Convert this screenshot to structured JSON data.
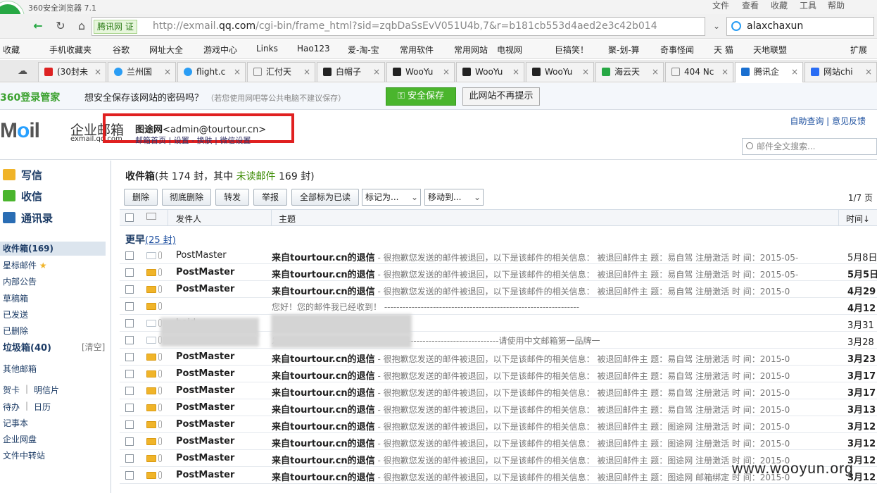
{
  "browser": {
    "app_title": "360安全浏览器 7.1",
    "menus": [
      "文件",
      "查看",
      "收藏",
      "工具",
      "帮助"
    ],
    "site_badge": "腾讯网 证",
    "url_prefix": "http://exmail.",
    "url_domain": "qq.com",
    "url_rest": "/cgi-bin/frame_html?sid=zqbDaSsEvV051U4b,7&r=b181cb553d4aed2e3c42b014",
    "search_text": "alaxchaxun"
  },
  "bookmarks": {
    "label": "收藏",
    "items": [
      "手机收藏夹",
      "谷歌",
      "网址大全",
      "游戏中心",
      "Links",
      "Hao123",
      "爱-淘-宝",
      "常用软件",
      "常用网站",
      "电视网",
      "巨搞笑！",
      "聚-划-算",
      "奇事怪闻",
      "天 猫",
      "天地联盟"
    ],
    "extend": "扩展"
  },
  "tabs": [
    "(30封未",
    "兰州国",
    "flight.c",
    "汇付天",
    "白帽子",
    "WooYu",
    "WooYu",
    "WooYu",
    "海云天",
    "404 Nc",
    "腾讯企",
    "网站chi"
  ],
  "password_bar": {
    "brand": "360登录管家",
    "question": "想安全保存该网站的密码吗？",
    "hint": "（若您使用网吧等公共电脑不建议保存）",
    "save_label": "安全保存",
    "no_label": "此网站不再提示"
  },
  "mail_header": {
    "logo_text": "Moil",
    "logo_cn": "企业邮箱",
    "logo_domain": "exmail.qq.com",
    "user_name": "图途网",
    "user_email": "<admin@tourtour.cn>",
    "user_links": "邮箱首页 | 设置 - 换肤 | 微信设置",
    "help_links": "自助查询 | 意见反馈",
    "search_placeholder": "邮件全文搜索..."
  },
  "sidebar": {
    "compose": "写信",
    "inbox_big": "收信",
    "contacts": "通讯录",
    "inbox": "收件箱(169)",
    "starred": "星标邮件",
    "internal": "内部公告",
    "drafts": "草稿箱",
    "sent": "已发送",
    "deleted": "已删除",
    "spam": "垃圾箱(40)",
    "spam_clear": "[清空]",
    "other": "其他邮箱",
    "greeting": "贺卡",
    "postcard": "明信片",
    "todo": "待办",
    "calendar": "日历",
    "notes": "记事本",
    "netdisk": "企业网盘",
    "transfer": "文件中转站"
  },
  "inbox": {
    "title": "收件箱",
    "summary": "(共 174 封，其中",
    "unread_label": "未读邮件",
    "unread_count": "169 封)",
    "toolbar": {
      "delete": "删除",
      "purge": "彻底删除",
      "forward": "转发",
      "report": "举报",
      "mark_all_read": "全部标为已读",
      "mark_as": "标记为...",
      "move_to": "移动到..."
    },
    "pager": "1/7 页",
    "columns": {
      "from": "发件人",
      "subject": "主题",
      "time": "时间↓"
    },
    "group_label": "更早",
    "group_count": "(25 封)",
    "rows": [
      {
        "from": "PostMaster",
        "subject": "来自tourtour.cn的退信",
        "preview": " - 很抱歉您发送的邮件被退回，以下是该邮件的相关信息：  被退回邮件主  题：易自驾 注册激活 时 间：2015-05-",
        "date": "5月8日",
        "unread": false
      },
      {
        "from": "PostMaster",
        "subject": "来自tourtour.cn的退信",
        "preview": " - 很抱歉您发送的邮件被退回，以下是该邮件的相关信息：  被退回邮件主  题：易自驾 注册激活 时 间：2015-05-",
        "date": "5月5日",
        "unread": true
      },
      {
        "from": "PostMaster",
        "subject": "来自tourtour.cn的退信",
        "preview": " - 很抱歉您发送的邮件被退回，以下是该邮件的相关信息：  被退回邮件主  题：易自驾 注册激活 时 间：2015-0",
        "date": "4月29",
        "unread": true
      },
      {
        "from": "",
        "subject": "",
        "preview": "您好！您的邮件我已经收到！  ----------------------------------------------------------------",
        "date": "4月12",
        "unread": true
      },
      {
        "from": "baid",
        "subject": "",
        "preview": "",
        "date": "3月31",
        "unread": false
      },
      {
        "from": "",
        "subject": "",
        "preview": "发给我的信件已经收到。--------------------------------------------请使用中文邮箱第一品牌一",
        "date": "3月28",
        "unread": false
      },
      {
        "from": "PostMaster",
        "subject": "来自tourtour.cn的退信",
        "preview": " - 很抱歉您发送的邮件被退回，以下是该邮件的相关信息：  被退回邮件主  题：易自驾 注册激活 时 间：2015-0",
        "date": "3月23",
        "unread": true
      },
      {
        "from": "PostMaster",
        "subject": "来自tourtour.cn的退信",
        "preview": " - 很抱歉您发送的邮件被退回，以下是该邮件的相关信息：  被退回邮件主  题：易自驾 注册激活 时 间：2015-0",
        "date": "3月17",
        "unread": true
      },
      {
        "from": "PostMaster",
        "subject": "来自tourtour.cn的退信",
        "preview": " - 很抱歉您发送的邮件被退回，以下是该邮件的相关信息：  被退回邮件主  题：易自驾 注册激活 时 间：2015-0",
        "date": "3月17",
        "unread": true
      },
      {
        "from": "PostMaster",
        "subject": "来自tourtour.cn的退信",
        "preview": " - 很抱歉您发送的邮件被退回，以下是该邮件的相关信息：  被退回邮件主  题：易自驾 注册激活 时 间：2015-0",
        "date": "3月13",
        "unread": true
      },
      {
        "from": "PostMaster",
        "subject": "来自tourtour.cn的退信",
        "preview": " - 很抱歉您发送的邮件被退回，以下是该邮件的相关信息：  被退回邮件主  题：图途网 注册激活 时 间：2015-0",
        "date": "3月12",
        "unread": true
      },
      {
        "from": "PostMaster",
        "subject": "来自tourtour.cn的退信",
        "preview": " - 很抱歉您发送的邮件被退回，以下是该邮件的相关信息：  被退回邮件主  题：图途网 注册激活 时 间：2015-0",
        "date": "3月12",
        "unread": true
      },
      {
        "from": "PostMaster",
        "subject": "来自tourtour.cn的退信",
        "preview": " - 很抱歉您发送的邮件被退回，以下是该邮件的相关信息：  被退回邮件主  题：图途网 注册激活 时 间：2015-0",
        "date": "3月12",
        "unread": true
      },
      {
        "from": "PostMaster",
        "subject": "来自tourtour.cn的退信",
        "preview": " - 很抱歉您发送的邮件被退回，以下是该邮件的相关信息：  被退回邮件主  题：图途网 邮箱绑定 时 间：2015-0",
        "date": "3月12",
        "unread": true
      }
    ]
  },
  "watermark": "www.wooyun.org",
  "colors": {
    "unread_env": "#f0b429",
    "read_env": "#b8c2cc",
    "highlight_box": "#e02020",
    "accent_green": "#4ab52d"
  }
}
